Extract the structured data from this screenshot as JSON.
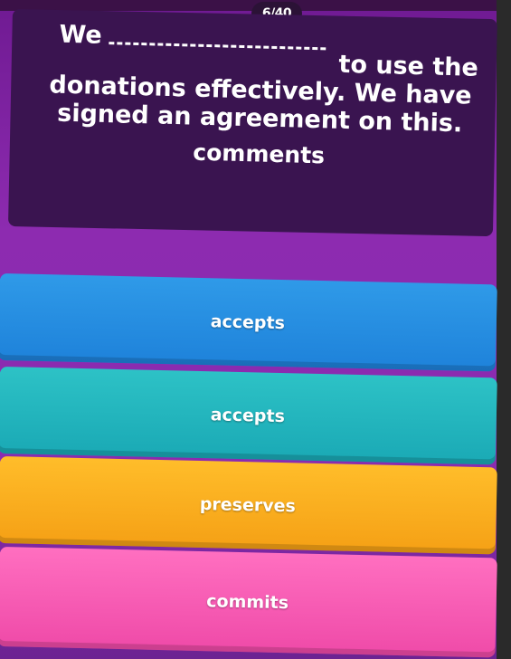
{
  "header": {
    "progress": "6/40"
  },
  "question": {
    "line1_start": "We",
    "line1_end": "to use the",
    "line2": "donations effectively. We have",
    "line3": "signed an agreement on this.",
    "hint": "comments"
  },
  "answers": [
    {
      "label": "accepts",
      "color": "#1e82da"
    },
    {
      "label": "accepts",
      "color": "#1aa9b5"
    },
    {
      "label": "preserves",
      "color": "#f5a015"
    },
    {
      "label": "commits",
      "color": "#ef4aa8"
    }
  ],
  "colors": {
    "background": "#8d2bb0",
    "card": "#3a1450"
  }
}
